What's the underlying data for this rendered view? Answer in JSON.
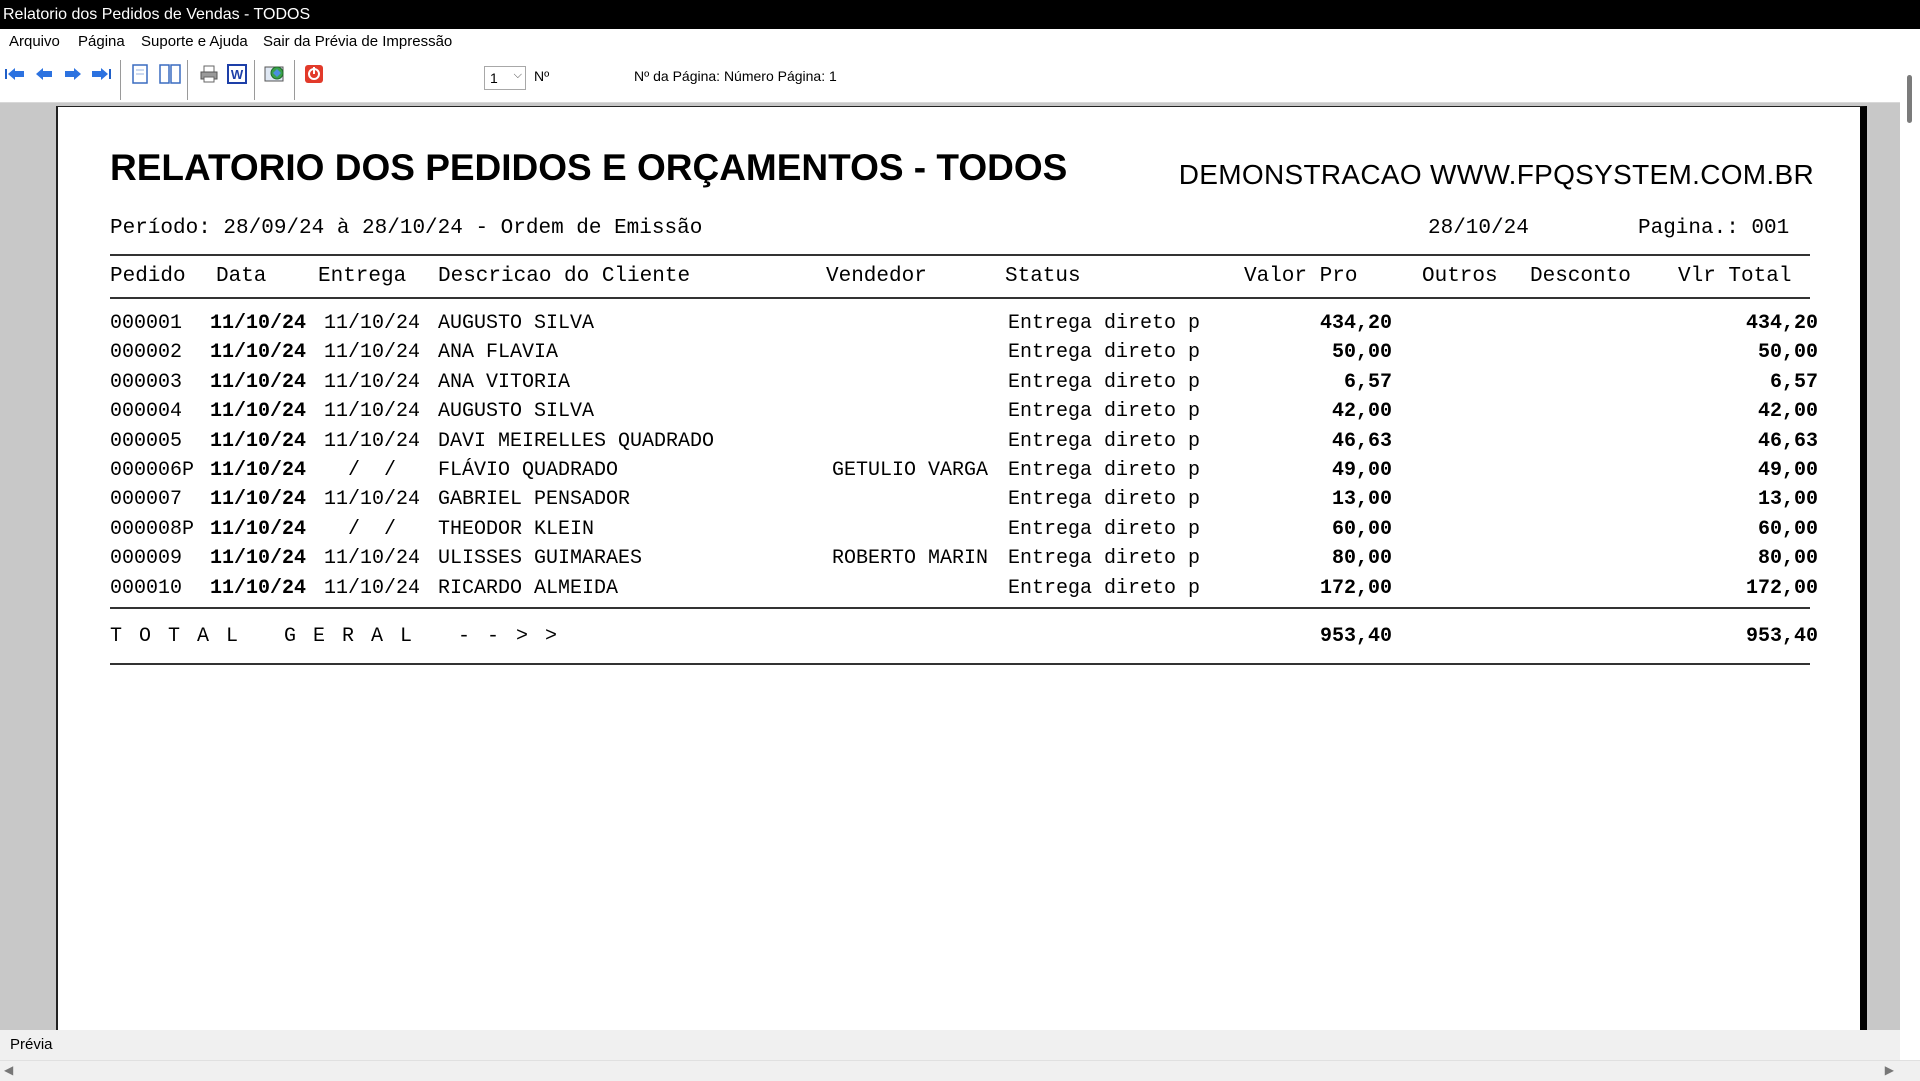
{
  "window": {
    "title": "Relatorio dos Pedidos de Vendas - TODOS"
  },
  "menu": [
    "Arquivo",
    "Página",
    "Suporte e Ajuda",
    "Sair da Prévia de Impressão"
  ],
  "toolbar": {
    "page_value": "1",
    "no_label": "Nº",
    "page_info": "Nº da Página: Número Página: 1",
    "icons": [
      "first-page-icon",
      "prev-page-icon",
      "next-page-icon",
      "last-page-icon",
      "single-page-icon",
      "two-pages-icon",
      "print-icon",
      "word-export-icon",
      "web-export-icon",
      "close-preview-icon"
    ]
  },
  "report": {
    "title": "RELATORIO DOS PEDIDOS E ORÇAMENTOS - TODOS",
    "demo": "DEMONSTRACAO WWW.FPQSYSTEM.COM.BR",
    "period": "Período: 28/09/24 à 28/10/24 - Ordem de Emissão",
    "date": "28/10/24",
    "page": "Pagina.: 001",
    "headers": {
      "pedido": "Pedido",
      "data": "Data",
      "entrega": "Entrega",
      "cliente": "Descricao do Cliente",
      "vendedor": "Vendedor",
      "status": "Status",
      "valor": "Valor Pro",
      "outros": "Outros",
      "desconto": "Desconto",
      "total": "Vlr Total"
    },
    "rows": [
      {
        "pedido": "000001",
        "data": "11/10/24",
        "entrega": "11/10/24",
        "cliente": "AUGUSTO SILVA",
        "vendedor": "",
        "status": "Entrega direto p",
        "valor": "434,20",
        "total": "434,20"
      },
      {
        "pedido": "000002",
        "data": "11/10/24",
        "entrega": "11/10/24",
        "cliente": "ANA FLAVIA",
        "vendedor": "",
        "status": "Entrega direto p",
        "valor": "50,00",
        "total": "50,00"
      },
      {
        "pedido": "000003",
        "data": "11/10/24",
        "entrega": "11/10/24",
        "cliente": "ANA VITORIA",
        "vendedor": "",
        "status": "Entrega direto p",
        "valor": "6,57",
        "total": "6,57"
      },
      {
        "pedido": "000004",
        "data": "11/10/24",
        "entrega": "11/10/24",
        "cliente": "AUGUSTO SILVA",
        "vendedor": "",
        "status": "Entrega direto p",
        "valor": "42,00",
        "total": "42,00"
      },
      {
        "pedido": "000005",
        "data": "11/10/24",
        "entrega": "11/10/24",
        "cliente": "DAVI MEIRELLES QUADRADO",
        "vendedor": "",
        "status": "Entrega direto p",
        "valor": "46,63",
        "total": "46,63"
      },
      {
        "pedido": "000006P",
        "data": "11/10/24",
        "entrega": "  /  /",
        "cliente": "FLÁVIO QUADRADO",
        "vendedor": "GETULIO VARGA",
        "status": "Entrega direto p",
        "valor": "49,00",
        "total": "49,00"
      },
      {
        "pedido": "000007",
        "data": "11/10/24",
        "entrega": "11/10/24",
        "cliente": "GABRIEL PENSADOR",
        "vendedor": "",
        "status": "Entrega direto p",
        "valor": "13,00",
        "total": "13,00"
      },
      {
        "pedido": "000008P",
        "data": "11/10/24",
        "entrega": "  /  /",
        "cliente": "THEODOR KLEIN",
        "vendedor": "",
        "status": "Entrega direto p",
        "valor": "60,00",
        "total": "60,00"
      },
      {
        "pedido": "000009",
        "data": "11/10/24",
        "entrega": "11/10/24",
        "cliente": "ULISSES GUIMARAES",
        "vendedor": "ROBERTO MARIN",
        "status": "Entrega direto p",
        "valor": "80,00",
        "total": "80,00"
      },
      {
        "pedido": "000010",
        "data": "11/10/24",
        "entrega": "11/10/24",
        "cliente": "RICARDO ALMEIDA",
        "vendedor": "",
        "status": "Entrega direto p",
        "valor": "172,00",
        "total": "172,00"
      }
    ],
    "total_label": "TOTAL GERAL -->>",
    "total_valor": "953,40",
    "total_total": "953,40"
  },
  "statusbar": {
    "text": "Prévia"
  }
}
